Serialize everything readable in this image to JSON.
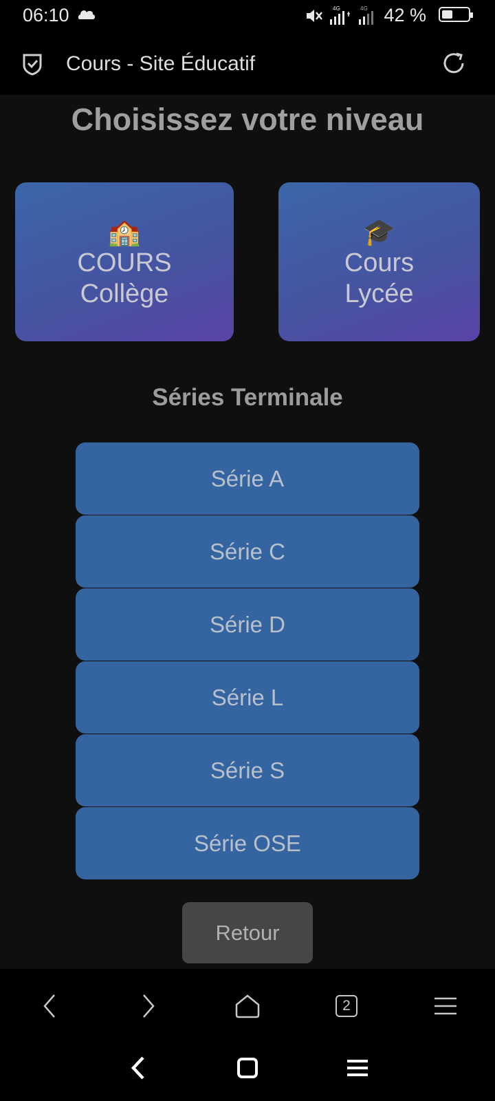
{
  "status_bar": {
    "time": "06:10",
    "network": "4G",
    "battery_percent": "42 %",
    "battery_level": 0.42
  },
  "browser": {
    "title": "Cours - Site Éducatif"
  },
  "page": {
    "title": "Choisissez votre niveau",
    "cards": [
      {
        "emoji": "🏫",
        "line1": "COURS",
        "line2": "Collège"
      },
      {
        "emoji": "🎓",
        "line1": "Cours",
        "line2": "Lycée"
      }
    ],
    "section_title": "Séries Terminale",
    "series": [
      "Série A",
      "Série C",
      "Série D",
      "Série L",
      "Série S",
      "Série OSE"
    ],
    "back_label": "Retour"
  },
  "browser_nav": {
    "tab_count": "2"
  },
  "colors": {
    "background": "#0f0f0f",
    "series_button": "#3465a0",
    "card_gradient_start": "#3b66a9",
    "card_gradient_end": "#5a43a6",
    "back_button": "#464646"
  }
}
